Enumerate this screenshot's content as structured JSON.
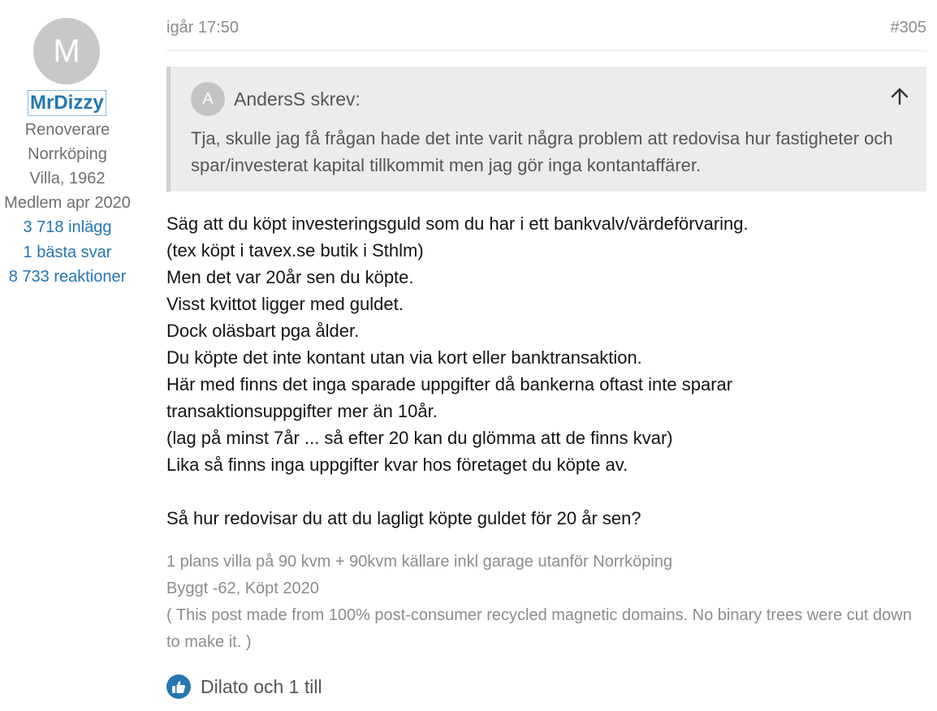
{
  "user": {
    "avatar_letter": "M",
    "username": "MrDizzy",
    "title": "Renoverare",
    "location": "Norrköping",
    "house": "Villa, 1962",
    "member_since": "Medlem apr 2020",
    "posts": "3 718 inlägg",
    "best_answers": "1 bästa svar",
    "reactions": "8 733 reaktioner"
  },
  "post": {
    "date": "igår 17:50",
    "number": "#305"
  },
  "quote": {
    "avatar_letter": "A",
    "author": "AndersS skrev:",
    "text": "Tja, skulle jag få frågan hade det inte varit några problem att redovisa hur fastigheter och spar/investerat kapital tillkommit men jag gör inga kontantaffärer."
  },
  "body": {
    "lines": [
      "Säg att du köpt investeringsguld som du har i ett bankvalv/värdeförvaring.",
      "(tex köpt i tavex.se butik i Sthlm)",
      "Men det var 20år sen du köpte.",
      "Visst kvittot ligger med guldet.",
      "Dock oläsbart pga ålder.",
      "Du köpte det inte kontant utan via kort eller banktransaktion.",
      "Här med finns det inga sparade uppgifter då bankerna oftast inte sparar",
      "transaktionsuppgifter mer än 10år.",
      "(lag på minst 7år ... så efter 20 kan du glömma att de finns kvar)",
      "Lika så finns inga uppgifter kvar hos företaget du köpte av."
    ],
    "question": "Så hur redovisar du att du lagligt köpte guldet för 20 år sen?"
  },
  "signature": {
    "line1": "1 plans villa på 90 kvm + 90kvm källare inkl garage utanför Norrköping",
    "line2": "Byggt -62, Köpt 2020",
    "line3": "( This post made from 100% post-consumer recycled magnetic domains. No binary trees were cut down to make it. )"
  },
  "reactions": {
    "text": "Dilato och 1 till",
    "icon": "thumbs-up-icon",
    "icon_color": "#2577b1"
  },
  "colors": {
    "link": "#2577b1",
    "quote_bg": "#ececec",
    "muted": "#8c8c8c"
  }
}
